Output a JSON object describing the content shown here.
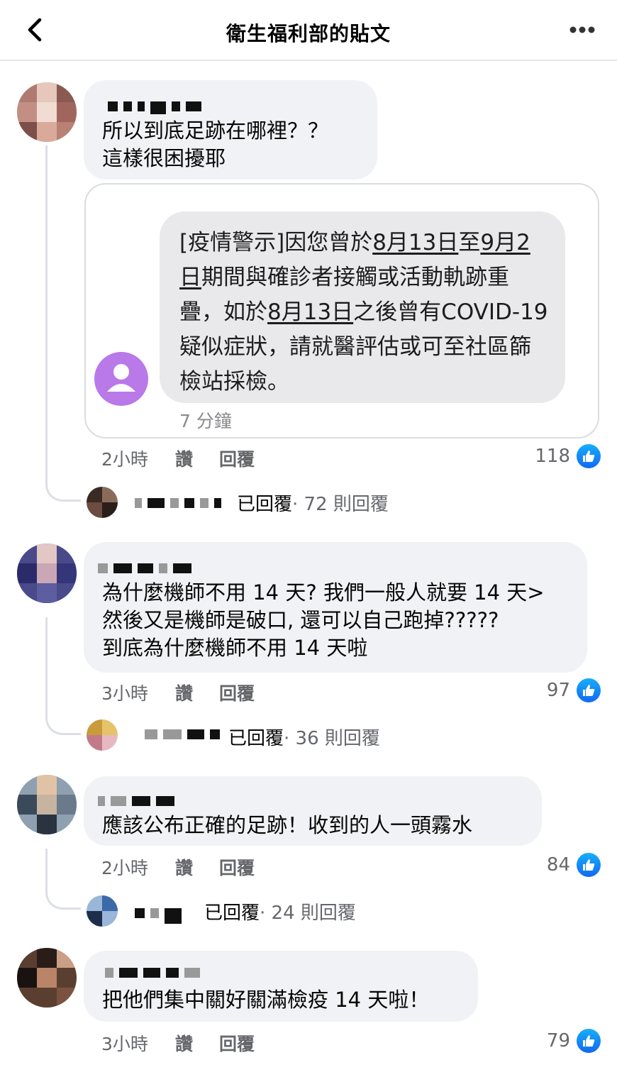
{
  "header": {
    "title": "衛生福利部的貼文",
    "back_icon": "chevron-left-icon",
    "more_icon": "more-horizontal-icon"
  },
  "colors": {
    "accent": "#1877f2",
    "bubble": "#f0f2f5",
    "muted": "#65676b",
    "sms_avatar": "#b979e8"
  },
  "comments": [
    {
      "text": "所以到底足跡在哪裡？？\n這樣很困擾耶",
      "time": "2小時",
      "like_label": "讚",
      "reply_label": "回覆",
      "reactions": "118",
      "replies_summary": "已回覆",
      "replies_count": "· 72 則回覆",
      "attachment": {
        "sms_prefix": "[疫情警示]因您曾於",
        "sms_date1": "8月13日",
        "sms_mid1": "至",
        "sms_date2": "9月2日",
        "sms_mid2": "期間與確診者接觸或活動軌跡重疊，如於",
        "sms_date3": "8月13日",
        "sms_suffix": "之後曾有COVID-19疑似症狀，請就醫評估或可至社區篩檢站採檢。",
        "sms_time": "7 分鐘"
      }
    },
    {
      "text": "為什麼機師不用 14 天? 我們一般人就要 14 天>\n然後又是機師是破口, 還可以自己跑掉?????\n到底為什麼機師不用 14 天啦",
      "time": "3小時",
      "like_label": "讚",
      "reply_label": "回覆",
      "reactions": "97",
      "replies_summary": "已回覆",
      "replies_count": "· 36 則回覆"
    },
    {
      "text": "應該公布正確的足跡！收到的人一頭霧水",
      "time": "2小時",
      "like_label": "讚",
      "reply_label": "回覆",
      "reactions": "84",
      "replies_summary": "已回覆",
      "replies_count": "· 24 則回覆"
    },
    {
      "text": "把他們集中關好關滿檢疫 14 天啦！",
      "time": "3小時",
      "like_label": "讚",
      "reply_label": "回覆",
      "reactions": "79"
    }
  ]
}
